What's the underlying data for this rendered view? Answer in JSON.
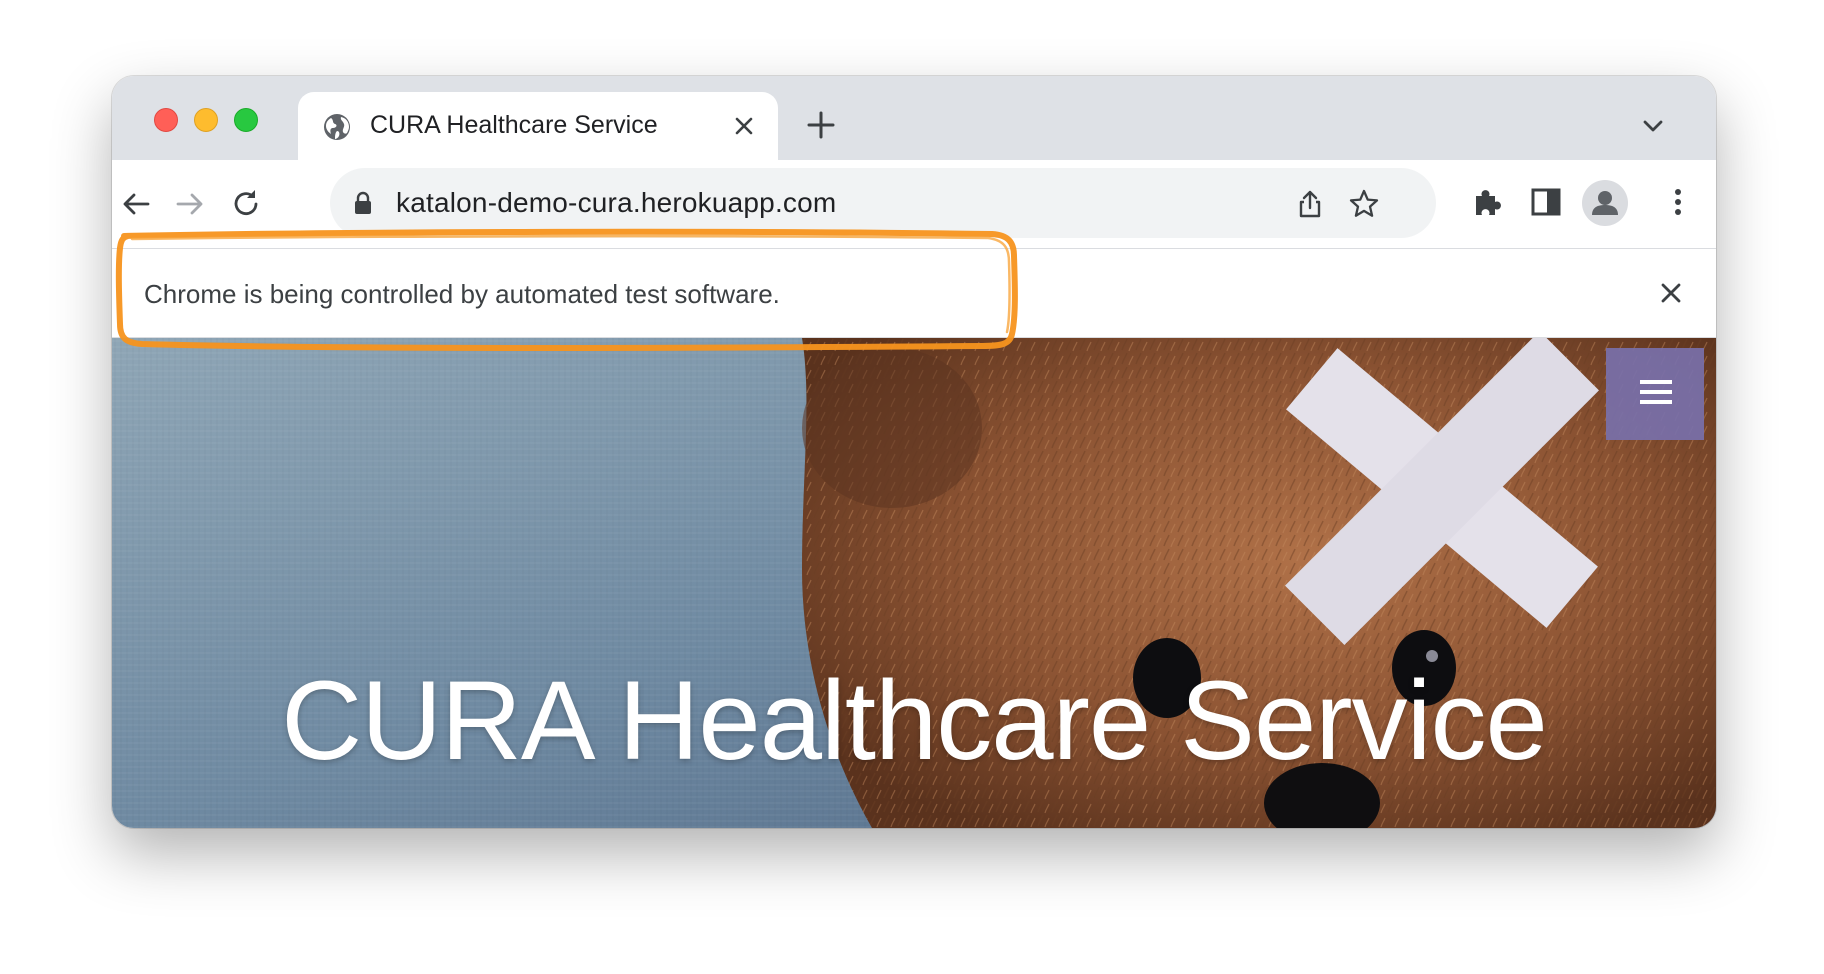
{
  "browser": {
    "tab": {
      "title": "CURA Healthcare Service",
      "icon": "globe-icon"
    },
    "address_bar": {
      "url": "katalon-demo-cura.herokuapp.com"
    }
  },
  "infobar": {
    "message": "Chrome is being controlled by automated test software."
  },
  "page": {
    "hero_title": "CURA Healthcare Service",
    "menu_button_color": "#7870aa"
  },
  "annotation": {
    "highlight_color": "#f7931e"
  }
}
